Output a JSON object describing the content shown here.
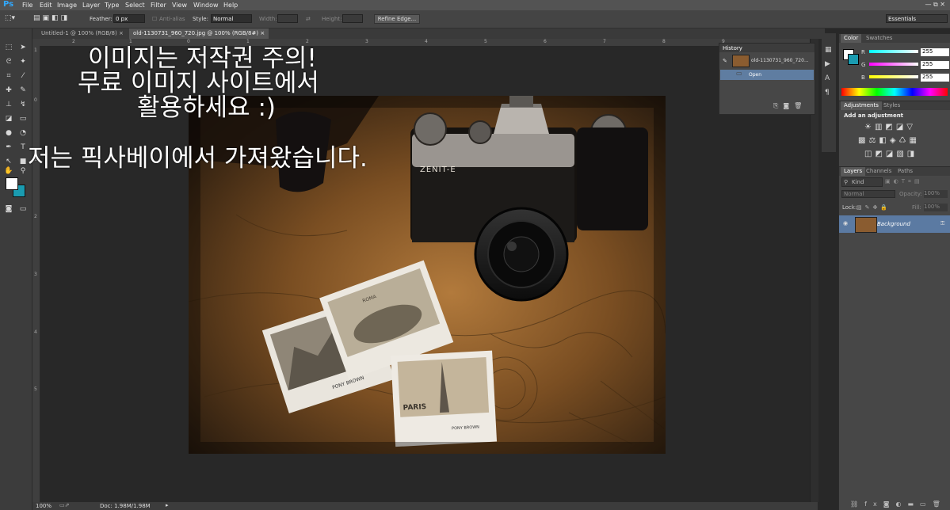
{
  "app": {
    "logo": "Ps"
  },
  "menu": [
    "File",
    "Edit",
    "Image",
    "Layer",
    "Type",
    "Select",
    "Filter",
    "View",
    "Window",
    "Help"
  ],
  "window_controls": "— ⧉ ✕",
  "options": {
    "feather_label": "Feather:",
    "feather_value": "0 px",
    "antialias_label": "Anti-alias",
    "style_label": "Style:",
    "style_value": "Normal",
    "width_label": "Width:",
    "height_label": "Height:",
    "refine_edge": "Refine Edge...",
    "workspace": "Essentials"
  },
  "tabs": [
    {
      "label": "Untitled-1 @ 100% (RGB/8)",
      "close": "×"
    },
    {
      "label": "old-1130731_960_720.jpg @ 100% (RGB/8#)",
      "close": "×"
    }
  ],
  "ruler": {
    "h": [
      "2",
      "1",
      "0",
      "1",
      "2",
      "3",
      "4",
      "5",
      "6",
      "7",
      "8",
      "9"
    ],
    "v": [
      "1",
      "0",
      "1",
      "2",
      "3",
      "4",
      "5"
    ]
  },
  "overlay_text": {
    "line1": "이미지는 저작권 주의!",
    "line2": "무료 이미지 사이트에서",
    "line3": "활용하세요 :)",
    "line4": "저는 픽사베이에서 가져왔습니다."
  },
  "photo_text": {
    "camera_brand": "ZENIT-E",
    "photo1": "ROMA",
    "photo2": "PONY BROWN",
    "photo3": "PARIS",
    "photo3_sub": "PONY BROWN"
  },
  "history": {
    "title": "History",
    "snapshot": "old-1130731_960_720...",
    "steps": [
      "Open"
    ]
  },
  "color_panel": {
    "tabs": [
      "Color",
      "Swatches"
    ],
    "channels": [
      {
        "label": "R",
        "value": "255"
      },
      {
        "label": "G",
        "value": "255"
      },
      {
        "label": "B",
        "value": "255"
      }
    ]
  },
  "adjustments": {
    "tabs": [
      "Adjustments",
      "Styles"
    ],
    "heading": "Add an adjustment"
  },
  "layers": {
    "tabs": [
      "Layers",
      "Channels",
      "Paths"
    ],
    "kind": "Kind",
    "blend_mode": "Normal",
    "opacity_label": "Opacity:",
    "opacity_value": "100%",
    "lock_label": "Lock:",
    "fill_label": "Fill:",
    "fill_value": "100%",
    "layer_name": "Background"
  },
  "status": {
    "zoom": "100%",
    "doc": "Doc: 1.98M/1.98M"
  },
  "colors": {
    "accent": "#31a8ff",
    "bg_swatch": "#1a9bb0",
    "fg_swatch": "#ffffff"
  }
}
